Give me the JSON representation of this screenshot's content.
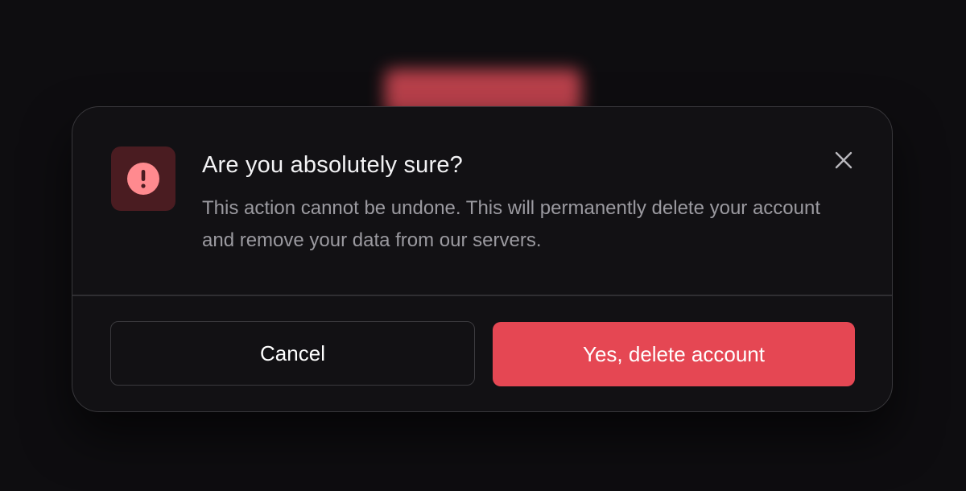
{
  "dialog": {
    "title": "Are you absolutely sure?",
    "description": "This action cannot be undone. This will permanently delete your account and remove your data from our servers.",
    "cancel_label": "Cancel",
    "confirm_label": "Yes, delete account",
    "icon": "alert-circle-icon",
    "close_icon": "close-icon"
  },
  "colors": {
    "accent": "#e54753",
    "icon_bg": "#4a1c21",
    "icon_fg": "#ff8a8f",
    "background": "#0e0d10"
  }
}
